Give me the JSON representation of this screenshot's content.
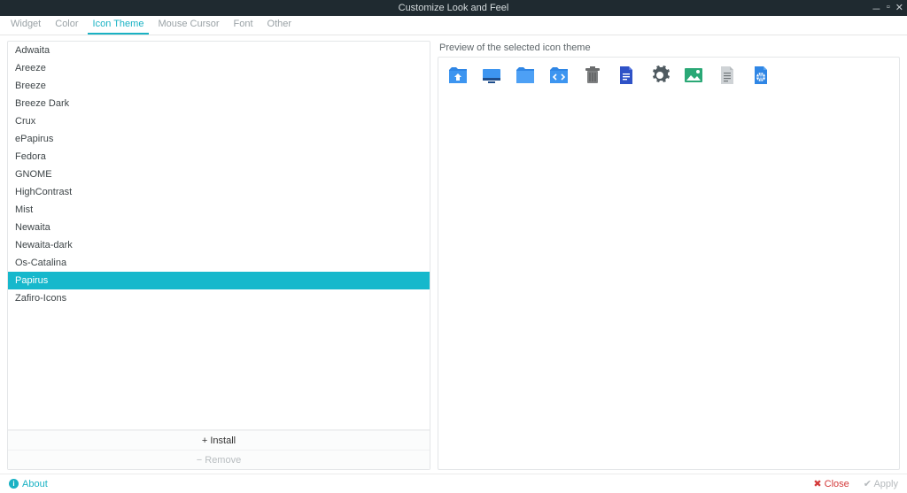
{
  "window": {
    "title": "Customize Look and Feel"
  },
  "tabs": [
    {
      "label": "Widget"
    },
    {
      "label": "Color"
    },
    {
      "label": "Icon Theme"
    },
    {
      "label": "Mouse Cursor"
    },
    {
      "label": "Font"
    },
    {
      "label": "Other"
    }
  ],
  "active_tab_index": 2,
  "icon_themes": [
    "Adwaita",
    "Areeze",
    "Breeze",
    "Breeze Dark",
    "Crux",
    "ePapirus",
    "Fedora",
    "GNOME",
    "HighContrast",
    "Mist",
    "Newaita",
    "Newaita-dark",
    "Os-Catalina",
    "Papirus",
    "Zafiro-Icons"
  ],
  "selected_theme_index": 13,
  "buttons": {
    "install": "+ Install",
    "remove": "− Remove"
  },
  "preview_label": "Preview of the selected icon theme",
  "preview_icons": [
    "user-home-folder-icon",
    "desktop-folder-icon",
    "folder-icon",
    "code-folder-icon",
    "trash-icon",
    "document-icon",
    "settings-icon",
    "image-icon",
    "text-file-icon",
    "html-file-icon"
  ],
  "footer": {
    "about": "About",
    "close": "Close",
    "apply": "Apply"
  },
  "colors": {
    "accent": "#16b8cc",
    "folder_blue": "#2f86e5",
    "dark_panel": "#1f2a30"
  }
}
